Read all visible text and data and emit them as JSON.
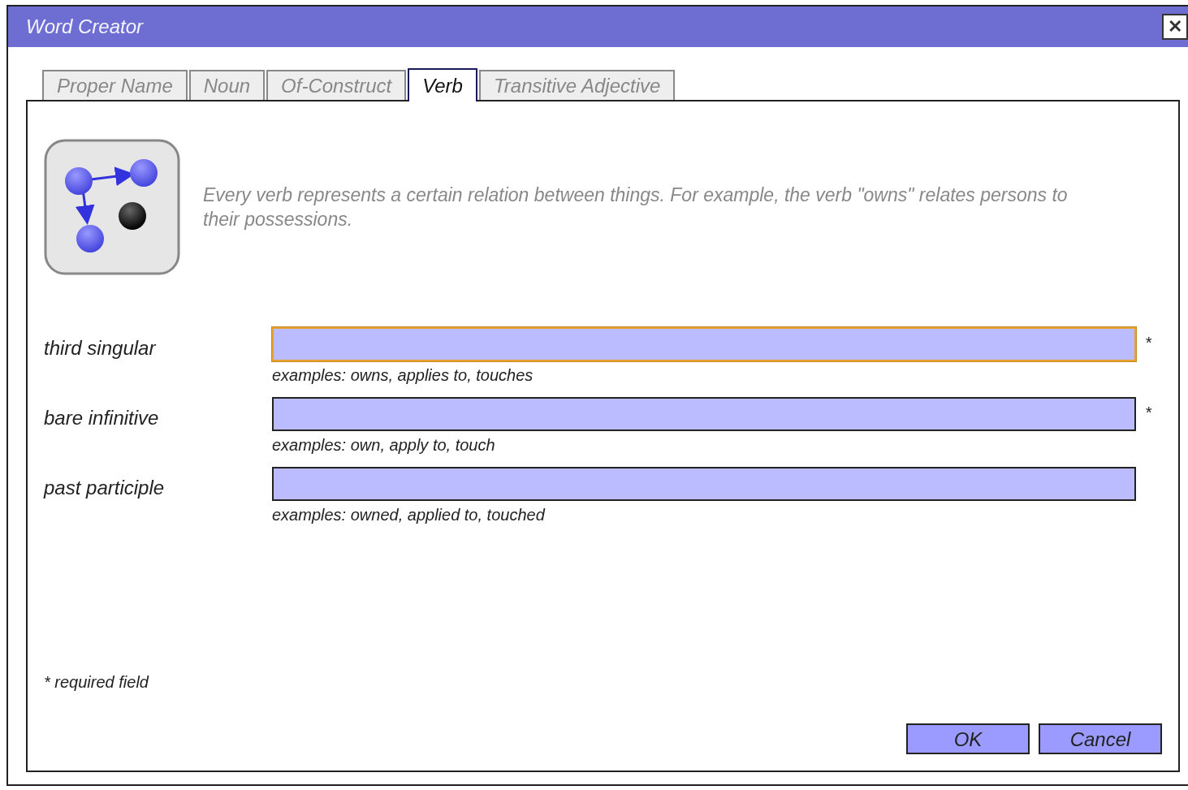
{
  "window": {
    "title": "Word Creator"
  },
  "tabs": [
    {
      "label": "Proper Name",
      "selected": false
    },
    {
      "label": "Noun",
      "selected": false
    },
    {
      "label": "Of-Construct",
      "selected": false
    },
    {
      "label": "Verb",
      "selected": true
    },
    {
      "label": "Transitive Adjective",
      "selected": false
    }
  ],
  "description": "Every verb represents a certain relation between things. For example, the verb \"owns\" relates persons to their possessions.",
  "fields": [
    {
      "label": "third singular",
      "required_mark": "*",
      "focused": true,
      "hint": "examples: owns, applies to, touches"
    },
    {
      "label": "bare infinitive",
      "required_mark": "*",
      "focused": false,
      "hint": "examples: own, apply to, touch"
    },
    {
      "label": "past participle",
      "focused": false,
      "hint": "examples: owned, applied to, touched"
    }
  ],
  "required_note": "* required field",
  "buttons": [
    "OK",
    "Cancel"
  ],
  "close_button": "✕"
}
